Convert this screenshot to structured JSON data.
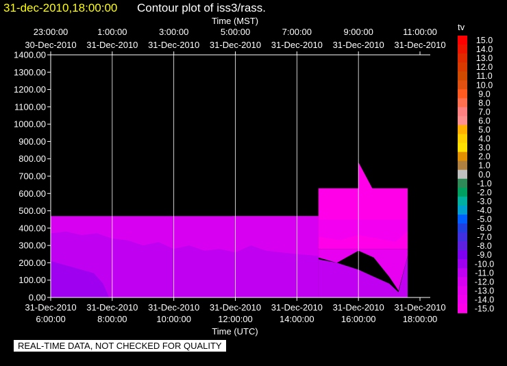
{
  "header": {
    "timestamp": "31-dec-2010,18:00:00",
    "title": "Contour plot of iss3/rass."
  },
  "notice": "REAL-TIME DATA, NOT CHECKED FOR QUALITY",
  "chart_data": {
    "type": "heatmap",
    "top_axis_label": "Time (MST)",
    "xlabel": "Time (UTC)",
    "ylabel": "",
    "ylim": [
      0,
      1400
    ],
    "y_ticks": [
      "0.00",
      "100.00",
      "200.00",
      "300.00",
      "400.00",
      "500.00",
      "600.00",
      "700.00",
      "800.00",
      "900.00",
      "1000.00",
      "1100.00",
      "1200.00",
      "1300.00",
      "1400.00"
    ],
    "xlim_utc_hours": [
      6,
      18
    ],
    "grid": true,
    "bottom_ticks": [
      {
        "hour": 6,
        "date": "31-Dec-2010",
        "time": "6:00:00"
      },
      {
        "hour": 8,
        "date": "31-Dec-2010",
        "time": "8:00:00"
      },
      {
        "hour": 10,
        "date": "31-Dec-2010",
        "time": "10:00:00"
      },
      {
        "hour": 12,
        "date": "31-Dec-2010",
        "time": "12:00:00"
      },
      {
        "hour": 14,
        "date": "31-Dec-2010",
        "time": "14:00:00"
      },
      {
        "hour": 16,
        "date": "31-Dec-2010",
        "time": "16:00:00"
      },
      {
        "hour": 18,
        "date": "31-Dec-2010",
        "time": "18:00:00"
      }
    ],
    "top_ticks": [
      {
        "hour": 6,
        "time": "23:00:00",
        "date": "30-Dec-2010"
      },
      {
        "hour": 8,
        "time": "1:00:00",
        "date": "31-Dec-2010"
      },
      {
        "hour": 10,
        "time": "3:00:00",
        "date": "31-Dec-2010"
      },
      {
        "hour": 12,
        "time": "5:00:00",
        "date": "31-Dec-2010"
      },
      {
        "hour": 14,
        "time": "7:00:00",
        "date": "31-Dec-2010"
      },
      {
        "hour": 16,
        "time": "9:00:00",
        "date": "31-Dec-2010"
      },
      {
        "hour": 18,
        "time": "11:00:00",
        "date": "31-Dec-2010"
      }
    ],
    "legend": {
      "title": "tv",
      "placement": "right",
      "values": [
        15,
        14,
        13,
        12,
        11,
        10,
        9,
        8,
        7,
        6,
        5,
        4,
        3,
        2,
        1,
        0,
        -1,
        -2,
        -3,
        -4,
        -5,
        -6,
        -7,
        -8,
        -9,
        -10,
        -11,
        -12,
        -13,
        -14,
        -15
      ],
      "labels": [
        "15.0",
        "14.0",
        "13.0",
        "12.0",
        "11.0",
        "10.0",
        "9.0",
        "8.0",
        "7.0",
        "6.0",
        "5.0",
        "4.0",
        "3.0",
        "2.0",
        "1.0",
        "0.0",
        "-1.0",
        "-2.0",
        "-3.0",
        "-4.0",
        "-5.0",
        "-6.0",
        "-7.0",
        "-8.0",
        "-9.0",
        "-10.0",
        "-11.0",
        "-12.0",
        "-13.0",
        "-14.0",
        "-15.0"
      ],
      "colors": [
        "#ff0000",
        "#ee1500",
        "#e02a00",
        "#d83a00",
        "#d04a00",
        "#e05010",
        "#ff5a20",
        "#ff6f50",
        "#ff8080",
        "#ff9090",
        "#ffb000",
        "#ffd000",
        "#ffe000",
        "#e09000",
        "#b08040",
        "#c0c0c0",
        "#2e8b57",
        "#00a060",
        "#00b0a0",
        "#00a0d0",
        "#0060ff",
        "#2040e0",
        "#4030e0",
        "#6020e0",
        "#8000f0",
        "#a000f0",
        "#c000f0",
        "#d800f0",
        "#e800f0",
        "#f400f0",
        "#ff00e8"
      ]
    },
    "regions": [
      {
        "level": -15,
        "polygon": [
          [
            16.0,
            780
          ],
          [
            16.0,
            280
          ],
          [
            17.6,
            280
          ],
          [
            17.6,
            630
          ],
          [
            16.45,
            630
          ]
        ]
      },
      {
        "level": -15,
        "polygon": [
          [
            14.7,
            630
          ],
          [
            16.0,
            630
          ],
          [
            16.0,
            280
          ],
          [
            14.7,
            280
          ]
        ]
      },
      {
        "level": -14,
        "polygon": [
          [
            11.8,
            470
          ],
          [
            14.7,
            470
          ],
          [
            14.7,
            230
          ],
          [
            14.0,
            250
          ],
          [
            13.4,
            270
          ],
          [
            12.9,
            290
          ],
          [
            12.6,
            350
          ],
          [
            12.2,
            420
          ],
          [
            11.9,
            470
          ]
        ]
      },
      {
        "level": -14,
        "polygon": [
          [
            14.7,
            450
          ],
          [
            17.6,
            450
          ],
          [
            17.6,
            380
          ],
          [
            17.2,
            320
          ],
          [
            16.6,
            340
          ],
          [
            16.0,
            360
          ],
          [
            15.4,
            330
          ],
          [
            14.7,
            350
          ]
        ]
      },
      {
        "level": -13,
        "polygon": [
          [
            14.7,
            280
          ],
          [
            17.6,
            280
          ],
          [
            17.6,
            240
          ],
          [
            17.3,
            40
          ],
          [
            17.0,
            120
          ],
          [
            16.5,
            230
          ],
          [
            16.0,
            270
          ],
          [
            15.3,
            200
          ],
          [
            14.7,
            230
          ]
        ]
      },
      {
        "level": -12,
        "polygon": [
          [
            6.0,
            470
          ],
          [
            14.7,
            470
          ],
          [
            14.7,
            0
          ],
          [
            6.0,
            0
          ]
        ]
      },
      {
        "level": -11,
        "polygon": [
          [
            6.0,
            370
          ],
          [
            6.5,
            380
          ],
          [
            7.0,
            360
          ],
          [
            7.5,
            370
          ],
          [
            8.0,
            340
          ],
          [
            8.5,
            330
          ],
          [
            9.0,
            300
          ],
          [
            9.5,
            320
          ],
          [
            10.0,
            280
          ],
          [
            10.5,
            300
          ],
          [
            11.0,
            270
          ],
          [
            11.5,
            280
          ],
          [
            12.0,
            260
          ],
          [
            12.5,
            300
          ],
          [
            13.0,
            270
          ],
          [
            13.5,
            260
          ],
          [
            14.0,
            250
          ],
          [
            14.7,
            240
          ],
          [
            14.7,
            0
          ],
          [
            6.0,
            0
          ]
        ]
      },
      {
        "level": -11,
        "polygon": [
          [
            14.7,
            220
          ],
          [
            15.3,
            200
          ],
          [
            16.0,
            160
          ],
          [
            16.5,
            120
          ],
          [
            17.0,
            80
          ],
          [
            17.3,
            30
          ],
          [
            17.6,
            240
          ],
          [
            17.6,
            0
          ],
          [
            14.7,
            0
          ]
        ]
      },
      {
        "level": -10,
        "polygon": [
          [
            6.0,
            210
          ],
          [
            6.4,
            190
          ],
          [
            7.0,
            160
          ],
          [
            7.4,
            140
          ],
          [
            7.7,
            80
          ],
          [
            7.9,
            0
          ],
          [
            6.0,
            0
          ]
        ]
      }
    ]
  }
}
